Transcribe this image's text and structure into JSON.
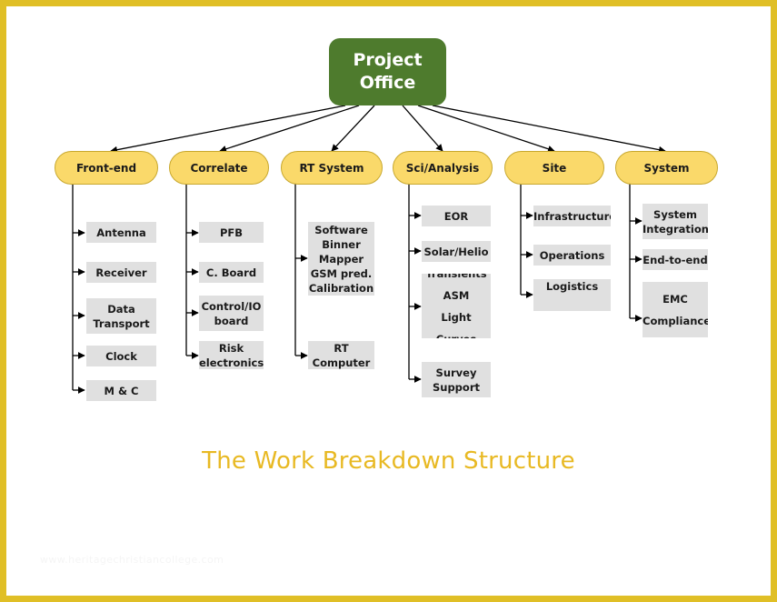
{
  "diagram": {
    "caption": "The Work Breakdown Structure",
    "watermark": "www.heritagechristiancollege.com",
    "colors": {
      "frame": "#e0bf26",
      "root_fill": "#4e7b2d",
      "root_text": "#ffffff",
      "pill_fill": "#fad96a",
      "pill_border": "#c8a82e",
      "leaf_fill": "#e0e0e0",
      "leaf_text": "#1a1a1a",
      "caption_text": "#e8b923",
      "connector": "#000000",
      "background": "#ffffff"
    },
    "root": {
      "line1": "Project",
      "line2": "Office"
    },
    "branches": [
      {
        "label": "Front-end",
        "leaves": [
          {
            "lines": [
              "Antenna"
            ]
          },
          {
            "lines": [
              "Receiver"
            ]
          },
          {
            "lines": [
              "Data",
              "Transport"
            ]
          },
          {
            "lines": [
              "Clock"
            ]
          },
          {
            "lines": [
              "M & C"
            ]
          }
        ]
      },
      {
        "label": "Correlate",
        "leaves": [
          {
            "lines": [
              "PFB"
            ]
          },
          {
            "lines": [
              "C. Board"
            ]
          },
          {
            "lines": [
              "Control/IO",
              "board"
            ]
          },
          {
            "lines": [
              "Risk",
              "electronics"
            ]
          }
        ]
      },
      {
        "label": "RT System",
        "leaves": [
          {
            "lines": [
              "Software",
              "Binner",
              "Mapper",
              "GSM pred.",
              "Calibration"
            ]
          },
          {
            "lines": [
              "RT",
              "Computer"
            ]
          }
        ]
      },
      {
        "label": "Sci/Analysis",
        "leaves": [
          {
            "lines": [
              "EOR"
            ]
          },
          {
            "lines": [
              "Solar/Helio"
            ]
          },
          {
            "lines": [
              "Transients",
              "ASM",
              "Light Curves"
            ]
          },
          {
            "lines": [
              "Survey",
              "Support"
            ]
          }
        ]
      },
      {
        "label": "Site",
        "leaves": [
          {
            "lines": [
              "Infrastructure"
            ]
          },
          {
            "lines": [
              "Operations"
            ]
          },
          {
            "lines": [
              "Logistics"
            ]
          }
        ]
      },
      {
        "label": "System",
        "leaves": [
          {
            "lines": [
              "System",
              "Integration"
            ]
          },
          {
            "lines": [
              "End-to-end"
            ]
          },
          {
            "lines": [
              "EMC",
              "Compliance"
            ]
          }
        ]
      }
    ]
  }
}
